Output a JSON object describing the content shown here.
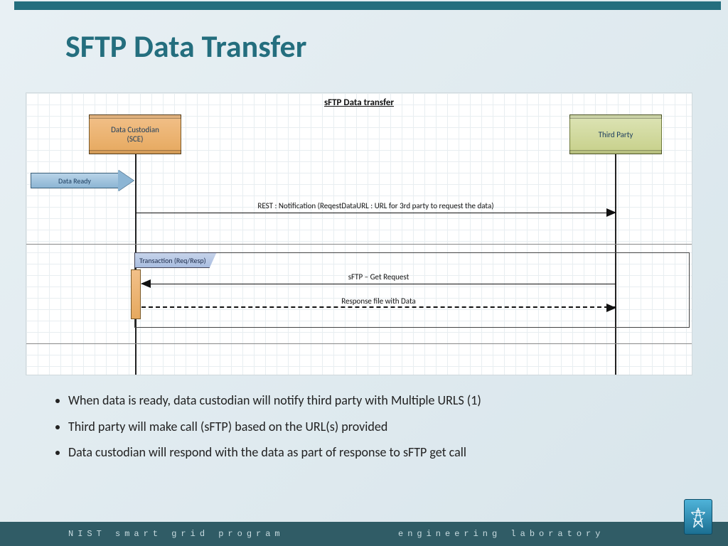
{
  "title": "SFTP Data Transfer",
  "diagram": {
    "title": "sFTP Data transfer",
    "participants": {
      "left": "Data Custodian\n(SCE)",
      "right": "Third Party"
    },
    "signal": "Data Ready",
    "messages": {
      "notify": "REST :  Notification (ReqestDataURL : URL for 3rd party to  request the data)",
      "get": "sFTP – Get Request",
      "resp": "Response file with Data"
    },
    "frame_label": "Transaction (Req/Resp)"
  },
  "bullets": [
    "When data is ready, data custodian will notify third party with Multiple URLS (1)",
    "Third party will make call (sFTP) based on the URL(s) provided",
    "Data custodian will respond with the data as part of response to sFTP get call"
  ],
  "footer": {
    "left": "NIST smart grid program",
    "right": "engineering laboratory"
  }
}
